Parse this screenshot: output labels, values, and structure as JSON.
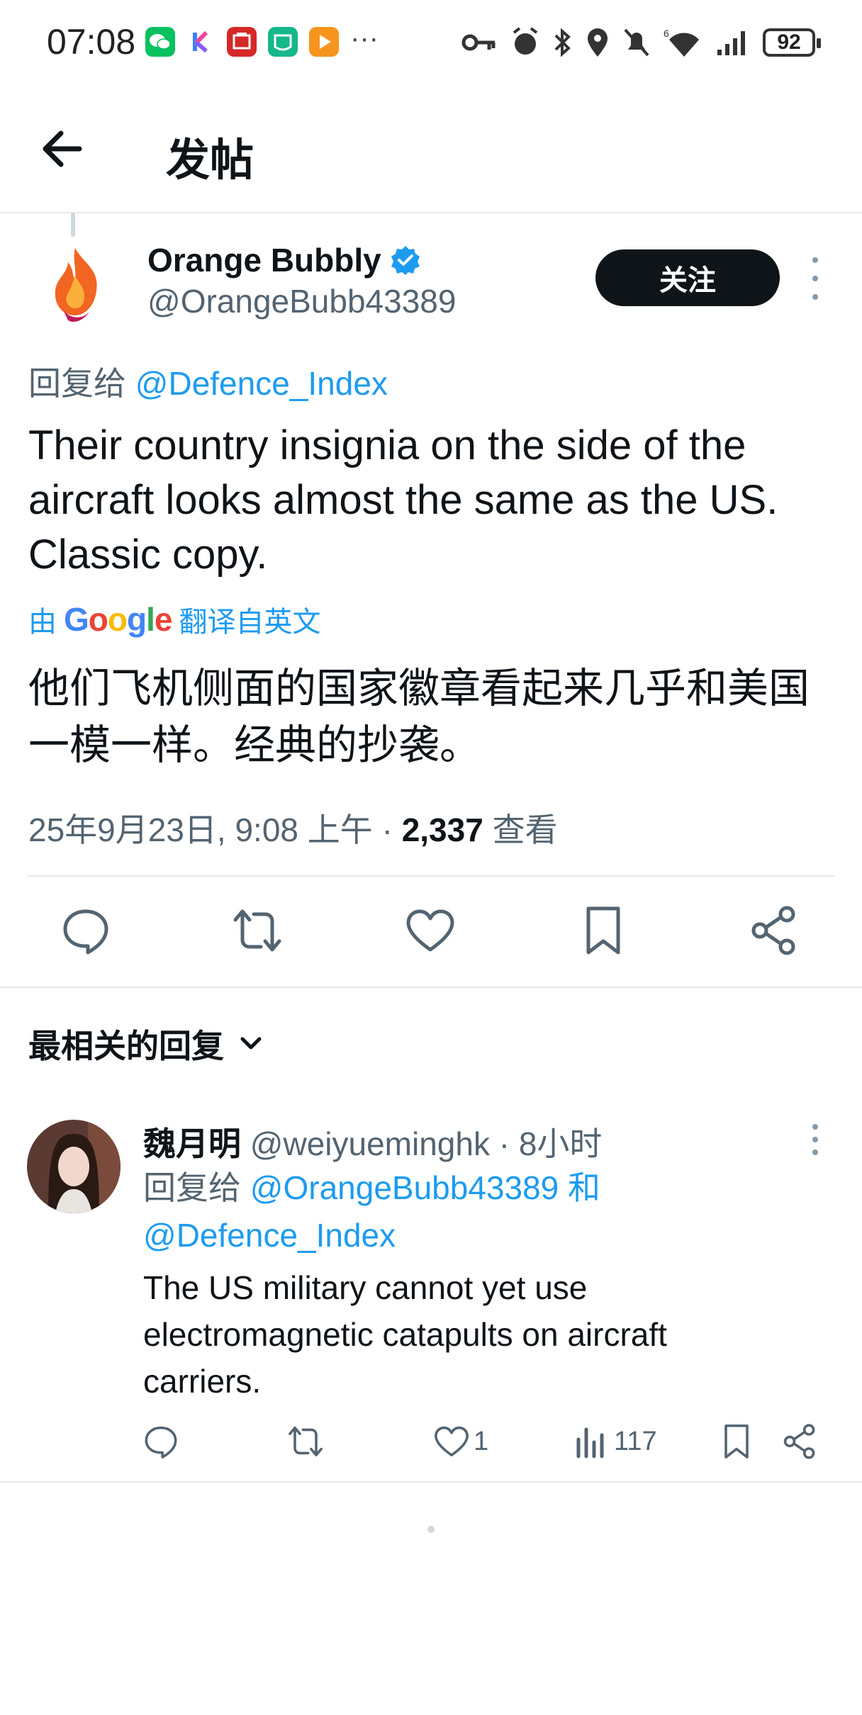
{
  "status_bar": {
    "time": "07:08",
    "more": "···",
    "battery": "92",
    "net_label": "6"
  },
  "header": {
    "title": "发帖"
  },
  "tweet": {
    "display_name": "Orange Bubbly",
    "handle": "@OrangeBubb43389",
    "follow_label": "关注",
    "reply_prefix": "回复给",
    "reply_target": "@Defence_Index",
    "text": "Their country insignia on the side of the aircraft looks almost the same as the US. Classic copy.",
    "translated_prefix": "由",
    "translated_brand": [
      "G",
      "o",
      "o",
      "g",
      "l",
      "e"
    ],
    "translated_suffix": "翻译自英文",
    "translation": "他们飞机侧面的国家徽章看起来几乎和美国一模一样。经典的抄袭。",
    "timestamp": "25年9月23日, 9:08 上午",
    "separator": "·",
    "view_count": "2,337",
    "view_label": "查看"
  },
  "sort": {
    "label": "最相关的回复"
  },
  "reply": {
    "display_name": "魏月明",
    "handle": "@weiyueminghk",
    "separator": "·",
    "age": "8小时",
    "reply_prefix": "回复给",
    "target1": "@OrangeBubb43389",
    "conjunction": "和",
    "target2": "@Defence_Index",
    "text": "The US military cannot yet use electromagnetic catapults on aircraft carriers.",
    "like_count": "1",
    "view_count": "117"
  },
  "colors": {
    "accent": "#1d9bf0",
    "text": "#0f1419",
    "secondary": "#536471",
    "divider": "#e7e9ea"
  },
  "icons": [
    "back-arrow-icon",
    "verified-badge-icon",
    "more-vertical-icon",
    "reply-icon",
    "retweet-icon",
    "like-icon",
    "bookmark-icon",
    "share-icon",
    "views-icon",
    "chevron-down-icon"
  ]
}
